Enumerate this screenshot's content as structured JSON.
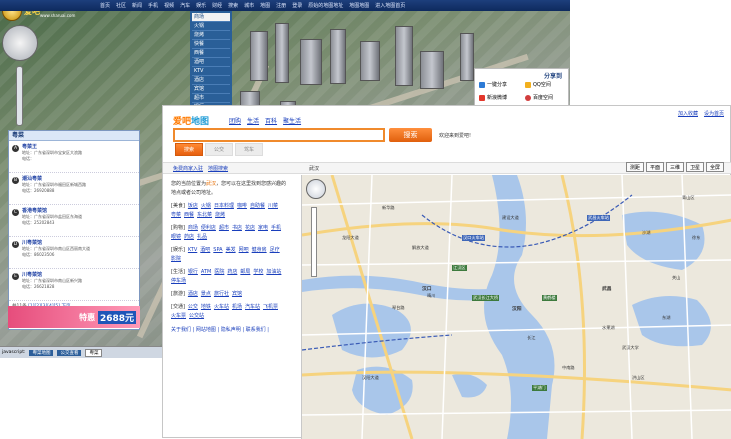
{
  "back": {
    "logo_text": "爱吧",
    "site_url": "www.sharuai.com",
    "topbar_items": [
      "首页",
      "社区",
      "新闻",
      "手机",
      "视频",
      "汽车",
      "娱乐",
      "财经",
      "搜索",
      "城市",
      "地图",
      "注册",
      "登录",
      "原始的地图地址",
      "地图地图",
      "进入地图首页"
    ],
    "category_menu": [
      "商场",
      "火锅",
      "烧烤",
      "快餐",
      "西餐",
      "酒吧",
      "KTV",
      "酒店",
      "宾馆",
      "超市",
      "银行",
      "医院"
    ],
    "share": {
      "title": "分享到",
      "items": [
        "一键分享",
        "QQ空间",
        "新浪微博",
        "百度空间"
      ]
    },
    "left_panel": {
      "title": "粤菜",
      "items": [
        {
          "n": "A",
          "name": "粤菜王",
          "addr": "地址：广东省深圳市宝安区大浪路",
          "tel": "电话："
        },
        {
          "n": "B",
          "name": "潮汕粤菜",
          "addr": "地址：广东省深圳市福田区新城西路",
          "tel": "电话：26920888"
        },
        {
          "n": "C",
          "name": "香港粤菜馆",
          "addr": "地址：广东省深圳市盐田区东海道",
          "tel": "电话：25202843"
        },
        {
          "n": "D",
          "name": "川粤菜馆",
          "addr": "地址：广东省深圳市南山区西丽南大道",
          "tel": "电话：86023506"
        },
        {
          "n": "E",
          "name": "川粤菜馆",
          "addr": "地址：广东省深圳市南山区新兴路",
          "tel": "电话：26621828"
        }
      ],
      "pager_prefix": "共11条",
      "pager_pages": "[1][2][3][4][5]",
      "pager_next": "下页"
    },
    "ad": {
      "text": "特惠",
      "price": "2688元"
    },
    "bottombar": {
      "left": "javascript:",
      "tab1": "粤菜地图",
      "tab2": "公交查看",
      "input": "粤菜"
    }
  },
  "front": {
    "logo_main": "爱吧",
    "logo_sub": "地图",
    "nav": [
      "团购",
      "生活",
      "百科",
      "聚生活"
    ],
    "right_links": [
      "加入收藏",
      "设为首页"
    ],
    "search_value": "",
    "search_button": "搜索",
    "welcome": "欢迎来到爱吧!",
    "tabs": [
      {
        "label": "搜索",
        "active": true
      },
      {
        "label": "公交",
        "active": false
      },
      {
        "label": "驾车",
        "active": false
      }
    ],
    "info_links": [
      "免费商家入驻",
      "地图搜索"
    ],
    "city": "武汉",
    "map_tools": [
      "测距",
      "平面",
      "三维",
      "卫星",
      "全屏"
    ],
    "sidebar": {
      "hint_pre": "您的当前位置为",
      "hint_city": "武汉",
      "hint_post": "，您可以在这里找到您感兴趣的地点或者公司地址。",
      "categories": [
        {
          "name": "[美食]",
          "links": [
            "饭店",
            "火锅",
            "日本料理",
            "咖啡",
            "自助餐",
            "川菜",
            "粤菜",
            "西餐",
            "东北菜",
            "烧烤"
          ]
        },
        {
          "name": "[购物]",
          "links": [
            "商场",
            "便利店",
            "超市",
            "书店",
            "花店",
            "家电",
            "手机",
            "眼镜",
            "药店",
            "礼品"
          ]
        },
        {
          "name": "[娱乐]",
          "links": [
            "KTV",
            "酒吧",
            "SPA",
            "美发",
            "网吧",
            "健身房",
            "足疗",
            "影院"
          ]
        },
        {
          "name": "[生活]",
          "links": [
            "银行",
            "ATM",
            "医院",
            "药店",
            "邮局",
            "学校",
            "加油站",
            "停车场"
          ]
        },
        {
          "name": "[旅游]",
          "links": [
            "酒店",
            "景点",
            "旅行社",
            "宾馆"
          ]
        },
        {
          "name": "[交通]",
          "links": [
            "公交",
            "地铁",
            "火车站",
            "机场",
            "汽车站",
            "飞机票",
            "火车票",
            "公交站"
          ]
        }
      ],
      "footer": [
        "关于我们",
        "网站地图",
        "隐私声明",
        "联系我们"
      ]
    },
    "map_labels": [
      "汉口",
      "汉阳",
      "武昌",
      "龙阳大道",
      "琴台路",
      "江汉区",
      "汉口火车站",
      "长江",
      "沙湖",
      "东湖",
      "洪山区",
      "青山区",
      "汉阳大道",
      "晴川",
      "武汉长江大桥",
      "武昌火车站",
      "武汉大学",
      "中南路",
      "水果湖",
      "关山",
      "平湖门",
      "徐东",
      "黄鹤楼",
      "新华路",
      "解放大道",
      "建设大道"
    ]
  }
}
